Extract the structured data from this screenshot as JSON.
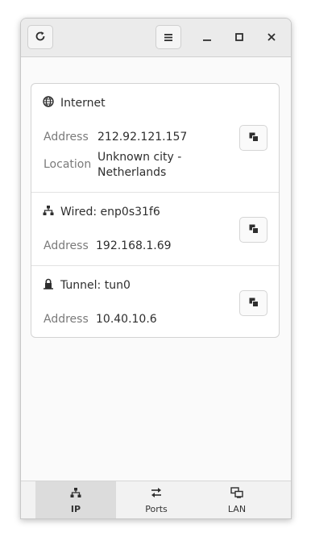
{
  "header": {
    "refresh_icon": "refresh-icon",
    "menu_icon": "hamburger-menu-icon",
    "minimize_icon": "minimize-icon",
    "maximize_icon": "maximize-icon",
    "close_icon": "close-icon"
  },
  "sections": [
    {
      "title": "Internet",
      "icon": "globe-icon",
      "fields": [
        {
          "label": "Address",
          "value": "212.92.121.157"
        },
        {
          "label": "Location",
          "value": "Unknown city - Netherlands"
        }
      ]
    },
    {
      "title": "Wired: enp0s31f6",
      "icon": "wired-network-icon",
      "fields": [
        {
          "label": "Address",
          "value": "192.168.1.69"
        }
      ]
    },
    {
      "title": "Tunnel: tun0",
      "icon": "lock-icon",
      "fields": [
        {
          "label": "Address",
          "value": "10.40.10.6"
        }
      ]
    }
  ],
  "tabs": [
    {
      "label": "IP",
      "icon": "network-tree-icon",
      "active": true
    },
    {
      "label": "Ports",
      "icon": "arrows-exchange-icon",
      "active": false
    },
    {
      "label": "LAN",
      "icon": "lan-computers-icon",
      "active": false
    }
  ]
}
